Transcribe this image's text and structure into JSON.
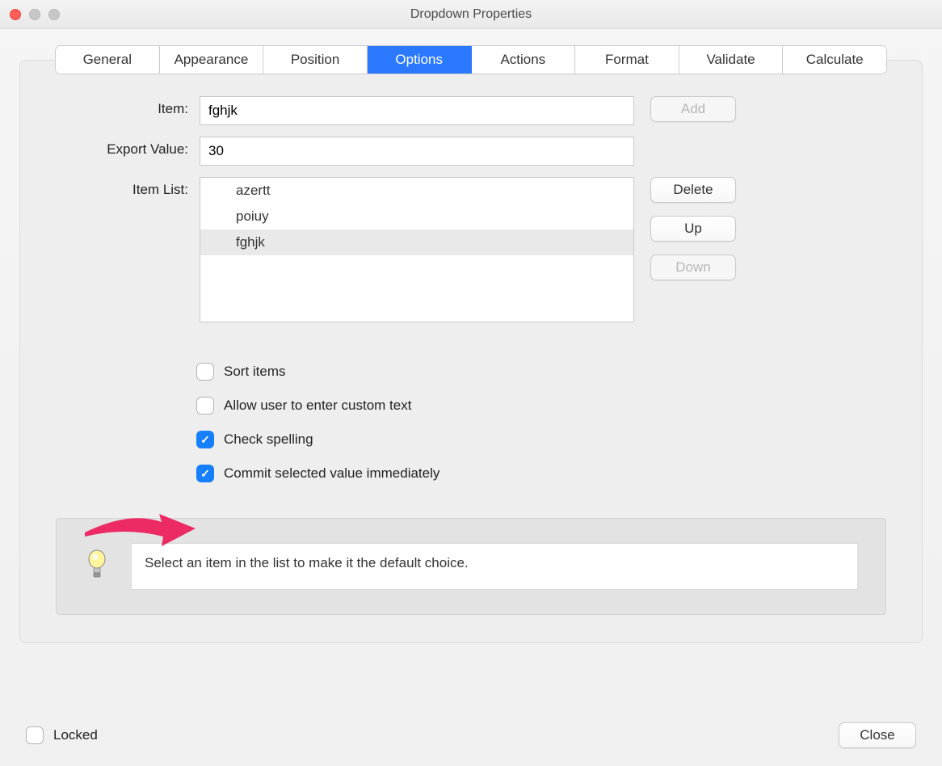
{
  "window": {
    "title": "Dropdown Properties"
  },
  "tabs": {
    "items": [
      "General",
      "Appearance",
      "Position",
      "Options",
      "Actions",
      "Format",
      "Validate",
      "Calculate"
    ],
    "active_index": 3
  },
  "fields": {
    "item_label": "Item:",
    "item_value": "fghjk",
    "export_label": "Export Value:",
    "export_value": "30",
    "list_label": "Item List:"
  },
  "list": {
    "items": [
      "azertt",
      "poiuy",
      "fghjk"
    ],
    "selected_index": 2
  },
  "buttons": {
    "add": "Add",
    "delete": "Delete",
    "up": "Up",
    "down": "Down",
    "close": "Close"
  },
  "checks": {
    "sort": {
      "label": "Sort items",
      "checked": false
    },
    "custom": {
      "label": "Allow user to enter custom text",
      "checked": false
    },
    "spell": {
      "label": "Check spelling",
      "checked": true
    },
    "commit": {
      "label": "Commit selected value immediately",
      "checked": true
    }
  },
  "hint": {
    "text": "Select an item in the list to make it the default choice."
  },
  "locked": {
    "label": "Locked",
    "checked": false
  }
}
